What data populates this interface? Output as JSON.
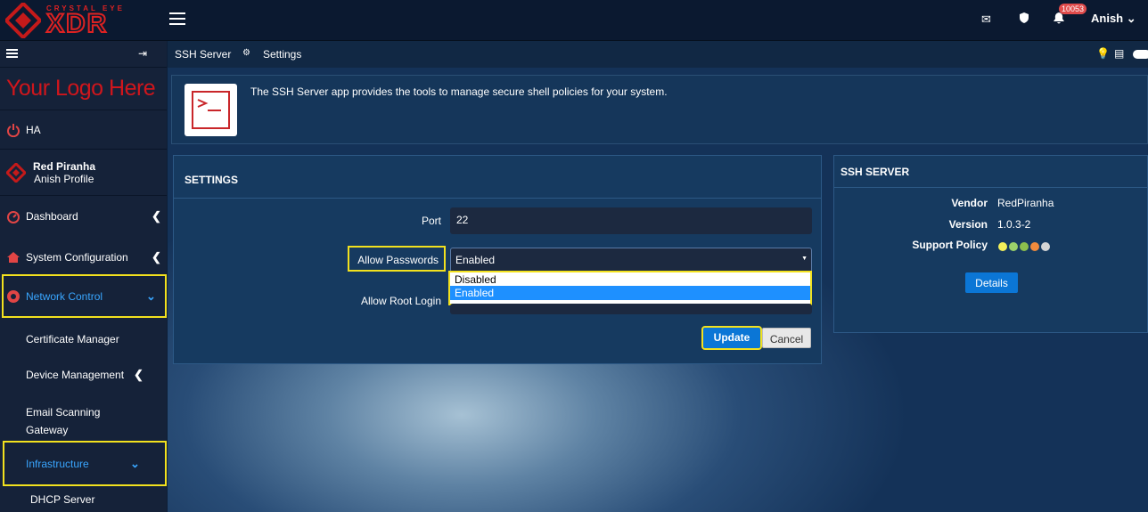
{
  "topbar": {
    "brand_tagline": "CRYSTAL EYE",
    "brand_name": "XDR",
    "notification_count": "10053",
    "user_name": "Anish"
  },
  "sidebar": {
    "custom_logo": "Your Logo Here",
    "ha_label": "HA",
    "profile": {
      "name": "Red Piranha",
      "subtitle": "Anish Profile"
    },
    "items": [
      {
        "label": "Dashboard"
      },
      {
        "label": "System Configuration"
      },
      {
        "label": "Network Control"
      },
      {
        "label": "Certificate Manager"
      },
      {
        "label": "Device Management"
      },
      {
        "label": "Email Scanning Gateway"
      },
      {
        "label": "Infrastructure"
      },
      {
        "label": "DHCP Server"
      }
    ]
  },
  "breadcrumb": {
    "app": "SSH Server",
    "page": "Settings"
  },
  "info": {
    "description": "The SSH Server app provides the tools to manage secure shell policies for your system."
  },
  "settings": {
    "title": "SETTINGS",
    "port_label": "Port",
    "port_value": "22",
    "allow_passwords_label": "Allow Passwords",
    "allow_passwords_value": "Enabled",
    "allow_passwords_options": [
      "Disabled",
      "Enabled"
    ],
    "allow_root_login_label": "Allow Root Login",
    "update_label": "Update",
    "cancel_label": "Cancel"
  },
  "ssh_server": {
    "title": "SSH SERVER",
    "vendor_label": "Vendor",
    "vendor_value": "RedPiranha",
    "version_label": "Version",
    "version_value": "1.0.3-2",
    "support_label": "Support Policy",
    "support_dot_colors": [
      "#f3f05a",
      "#9bd16a",
      "#8cbf4d",
      "#f08a3c",
      "#d6d6d6"
    ],
    "details_label": "Details"
  },
  "colors": {
    "accent": "#0b76d6",
    "highlight": "#f2e11e",
    "brand_red": "#d0161c"
  }
}
